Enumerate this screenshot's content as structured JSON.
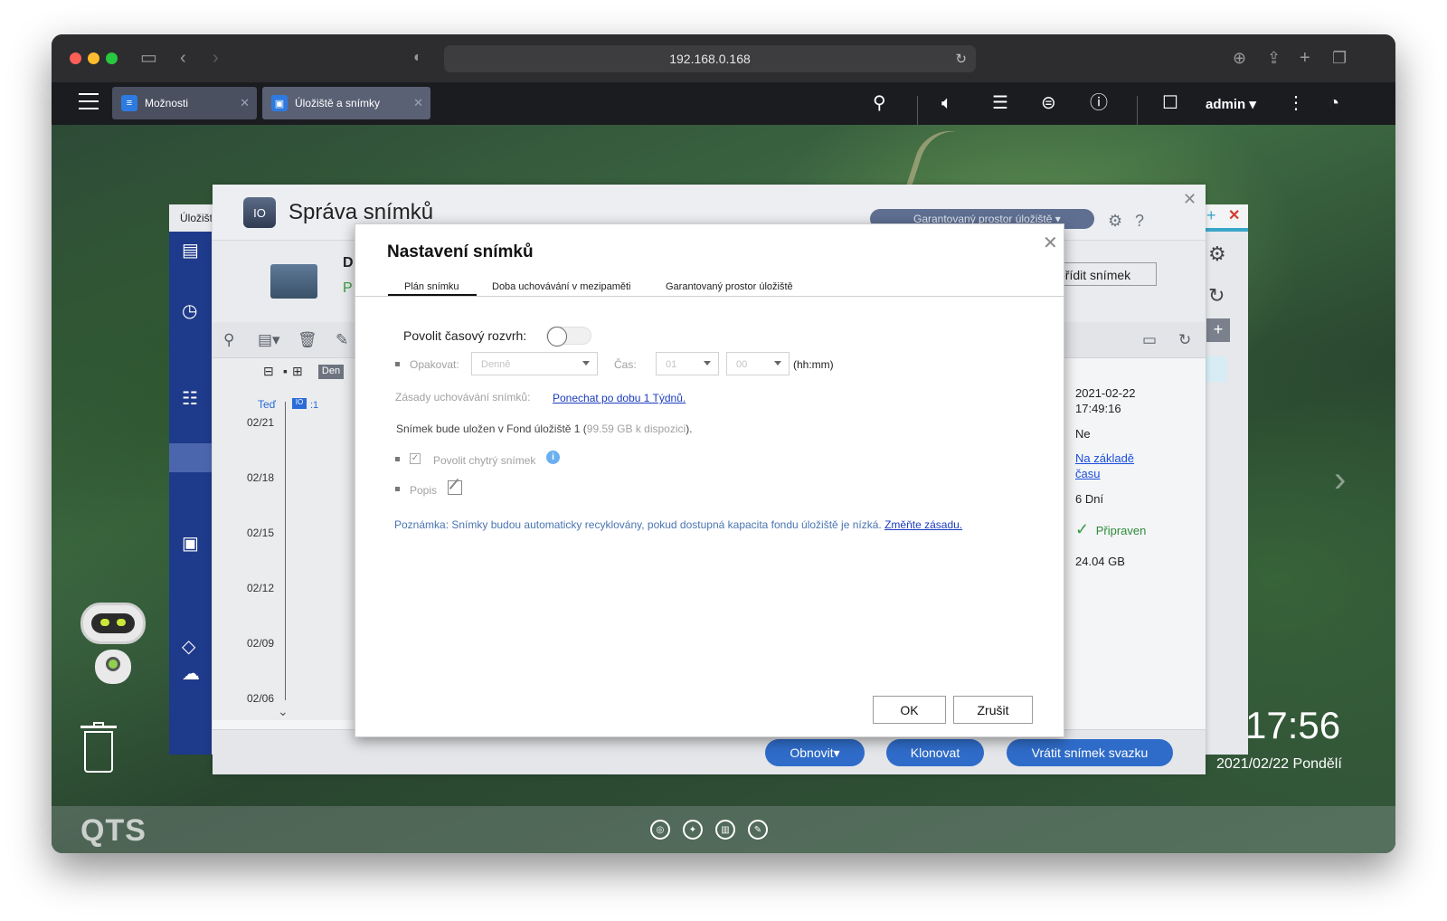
{
  "browser": {
    "url": "192.168.0.168"
  },
  "qts_topbar": {
    "tabs": [
      {
        "label": "Možnosti",
        "icon": "sliders-icon"
      },
      {
        "label": "Úložiště a snímky",
        "icon": "storage-icon"
      }
    ],
    "user": "admin"
  },
  "background_window": {
    "title": "Úložišt"
  },
  "snapshot_manager": {
    "title": "Správa snímků",
    "guaranteed_space_label": "Garantovaný prostor úložiště",
    "info_heading_initial": "D",
    "info_status_initial": "P",
    "take_snapshot_label": "ořídit snímek",
    "timeline": {
      "scale_label": "Den",
      "now_label": "Teď",
      "snapshot_count": ":1",
      "dates": [
        "02/21",
        "02/18",
        "02/15",
        "02/12",
        "02/09",
        "02/06"
      ]
    },
    "details": {
      "date": "2021-02-22",
      "time": "17:49:16",
      "value_no": "Ne",
      "retention_link_line1": "Na základě",
      "retention_link_line2": "času",
      "duration": "6 Dní",
      "status": "Připraven",
      "size": "24.04 GB"
    },
    "footer_buttons": {
      "restore": "Obnovit",
      "clone": "Klonovat",
      "revert": "Vrátit snímek svazku"
    }
  },
  "modal": {
    "title": "Nastavení snímků",
    "tabs": [
      "Plán snímku",
      "Doba uchovávání v mezipaměti",
      "Garantovaný prostor úložiště"
    ],
    "enable_schedule_label": "Povolit časový rozvrh:",
    "repeat_label": "Opakovat:",
    "repeat_value": "Denně",
    "time_label": "Čas:",
    "hour_value": "01",
    "minute_value": "00",
    "time_format": "(hh:mm)",
    "retention_label": "Zásady uchovávání snímků:",
    "retention_link": "Ponechat po dobu 1 Týdnů.",
    "storage_text_prefix": "Snímek bude uložen v Fond úložiště 1 (",
    "storage_available": "99.59 GB k dispozici",
    "storage_text_suffix": ").",
    "smart_snapshot_label": "Povolit chytrý snímek",
    "description_label": "Popis",
    "note_text": "Poznámka: Snímky budou automaticky recyklovány, pokud dostupná kapacita fondu úložiště je nízká.",
    "note_link": "Změňte zásadu.",
    "ok_label": "OK",
    "cancel_label": "Zrušit"
  },
  "desktop": {
    "clock_time": "17:56",
    "clock_date": "2021/02/22 Pondělí",
    "logo": "QTS"
  }
}
